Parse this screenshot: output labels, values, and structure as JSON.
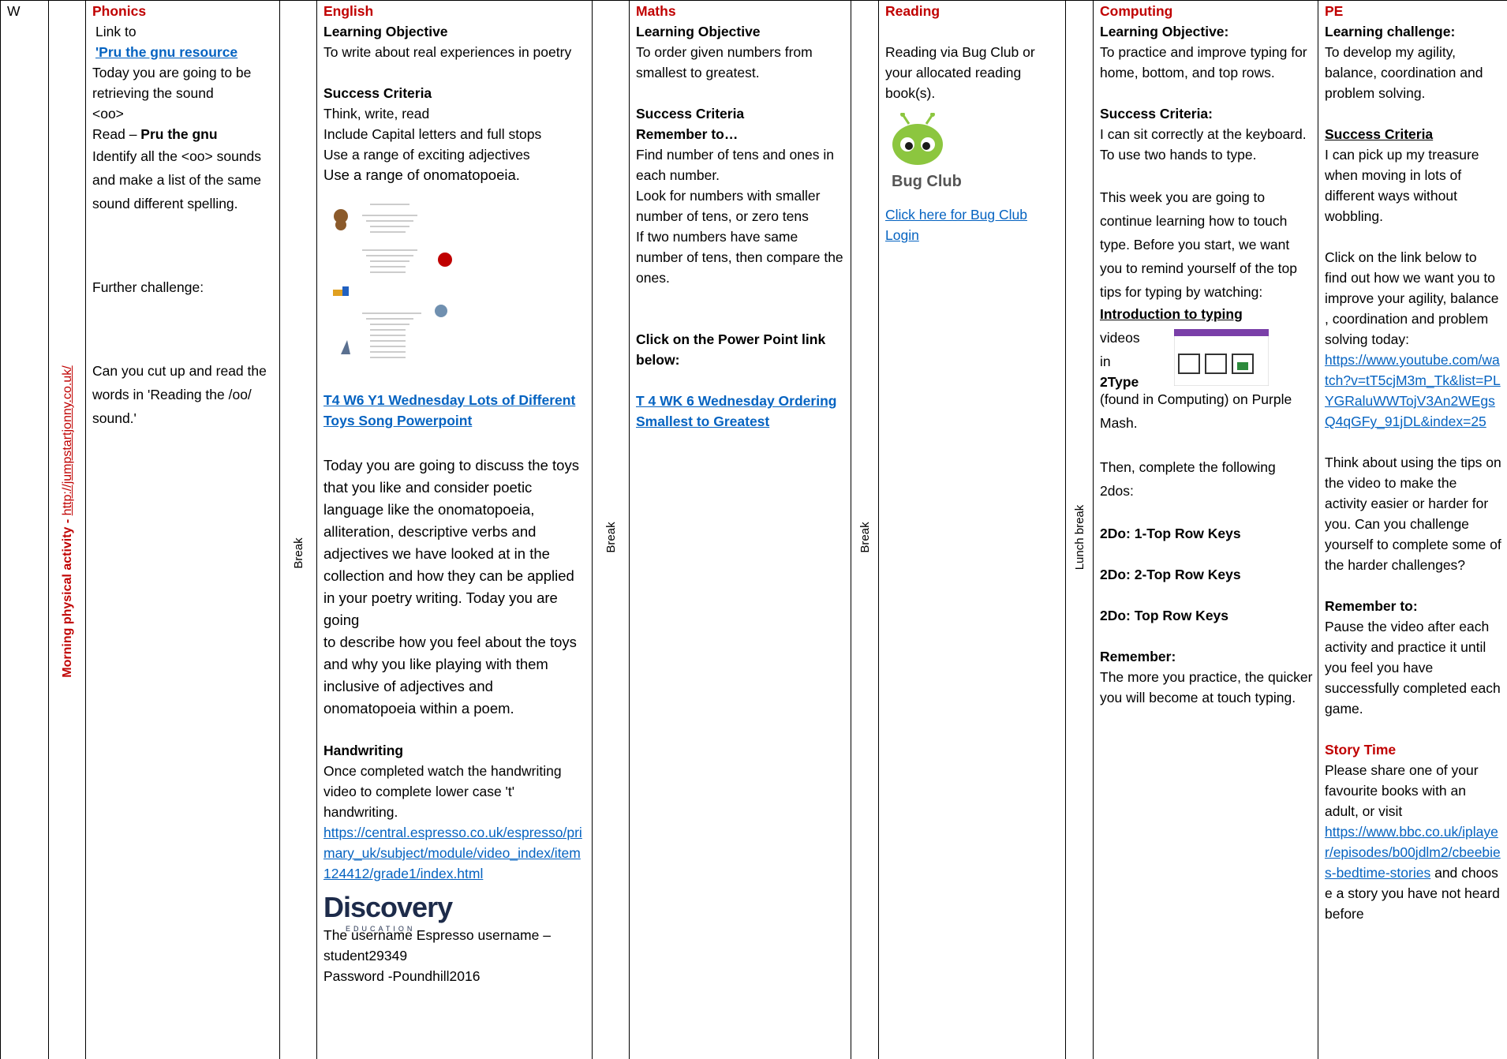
{
  "day_cell": "W",
  "morning": {
    "label": "Morning physical activity - ",
    "link": "http://jumpstartjonny.co.uk/"
  },
  "breaks": {
    "break1": "Break",
    "break2": "Break",
    "break3": "Break",
    "lunch": "Lunch break"
  },
  "phonics": {
    "title": "Phonics",
    "line1": "Link to",
    "resource_link": "'Pru the gnu resource",
    "p1": "Today you are going to be retrieving the sound",
    "p2": "<oo>",
    "read_prefix": "Read – ",
    "read_bold": "Pru the gnu",
    "p3": "Identify all the <oo> sounds and make a list of the same sound different spelling.",
    "further": "Further challenge:",
    "p4": "Can you cut up and read the words in 'Reading the /oo/ sound.'"
  },
  "english": {
    "title": "English",
    "lo_heading": "Learning Objective",
    "lo_text": " To write about real experiences in poetry",
    "sc_heading": "Success Criteria",
    "sc1": "Think, write, read",
    "sc2": "Include Capital letters and full stops",
    "sc3": "Use a range of exciting adjectives",
    "sc4": "Use a range of onomatopoeia.",
    "ppt_link": "T4 W6 Y1 Wednesday Lots of Different Toys Song Powerpoint",
    "today_lead": "Today you are going ",
    "today_text": "to discuss the toys that you like and consider poetic language like the onomatopoeia, alliteration, descriptive verbs and adjectives we have looked at in the collection and how they can be applied in your poetry writing. Today you are going",
    "today_text2": "to describe how you feel about the toys and why you like playing with them inclusive of adjectives and onomatopoeia within a poem.",
    "hw_heading": "Handwriting",
    "hw_text": "Once completed watch the handwriting video to complete lower case 't' handwriting.",
    "hw_link": "https://central.espresso.co.uk/espresso/primary_uk/subject/module/video_index/item124412/grade1/index.html",
    "logo_main": "Discovery",
    "logo_sub": "EDUCATION",
    "login1": "The username Espresso username – student29349",
    "login2": "Password -Poundhill2016"
  },
  "maths": {
    "title": "Maths",
    "lo_heading": "Learning Objective",
    "lo_text": "To order given numbers from smallest to greatest.",
    "sc_heading": "Success Criteria",
    "remember": "Remember to…",
    "r1": "Find number of tens and ones in each number.",
    "r2": "Look for numbers with smaller number of tens, or zero tens",
    "r3": "If two numbers have same number of tens, then compare the ones.",
    "click": "Click on the Power Point link below:",
    "link": "T 4 WK 6 Wednesday Ordering Smallest to Greatest"
  },
  "reading": {
    "title": "Reading",
    "text": "Reading via Bug Club or your allocated reading book(s).",
    "logo_text": "Bug Club",
    "link": "Click here for Bug Club Login"
  },
  "computing": {
    "title": "Computing",
    "lo_heading": "Learning Objective:",
    "lo_text": "To practice and improve typing for home, bottom, and top rows.",
    "sc_heading": "Success Criteria:",
    "sc1": "I can sit correctly at the keyboard.",
    "sc2": "To use two hands to type.",
    "p1": "This week you are going to continue learning how to touch type. Before you start, we want you to remind yourself of the top tips for typing by watching:",
    "intro": "Introduction to typing",
    "videos": "videos",
    "in": "in",
    "twotype": "2Type",
    "found": "(found in Computing) on Purple Mash.",
    "then": "Then, complete the following 2dos:",
    "d1": "2Do: 1-Top Row Keys",
    "d2": "2Do: 2-Top Row Keys",
    "d3": "2Do: Top Row Keys",
    "rem_heading": "Remember:",
    "rem_text": "The more you practice, the quicker you will become at touch typing."
  },
  "pe": {
    "title": "PE",
    "lc_heading": "Learning challenge:",
    "lc_text": "To develop my agility, balance, coordination and problem solving.",
    "sc_heading": "Success Criteria",
    "sc_text": "I can pick up my treasure when moving in lots of different ways without wobbling.",
    "p1": "Click on the link below to find out how we want you to improve your agility, balance , coordination and problem solving today:",
    "yt_link": "https://www.youtube.com/watch?v=tT5cjM3m_Tk&list=PLYGRaluWWTojV3An2WEgsQ4qGFy_91jDL&index=25",
    "p2": "Think about using the tips on the video to make the activity easier or harder for you. Can you challenge yourself to complete some of the harder challenges?",
    "rem_heading": "Remember to:",
    "rem_text": "Pause the video after each activity and practice it until you feel you have successfully completed each game.",
    "story_heading": "Story Time",
    "story_text": "Please share one of your favourite books with an adult, or visit",
    "bbc_link": "https://www.bbc.co.uk/iplayer/episodes/b00jdlm2/cbeebies-bedtime-stories",
    "story_tail": " and choose a story you have not heard before"
  }
}
